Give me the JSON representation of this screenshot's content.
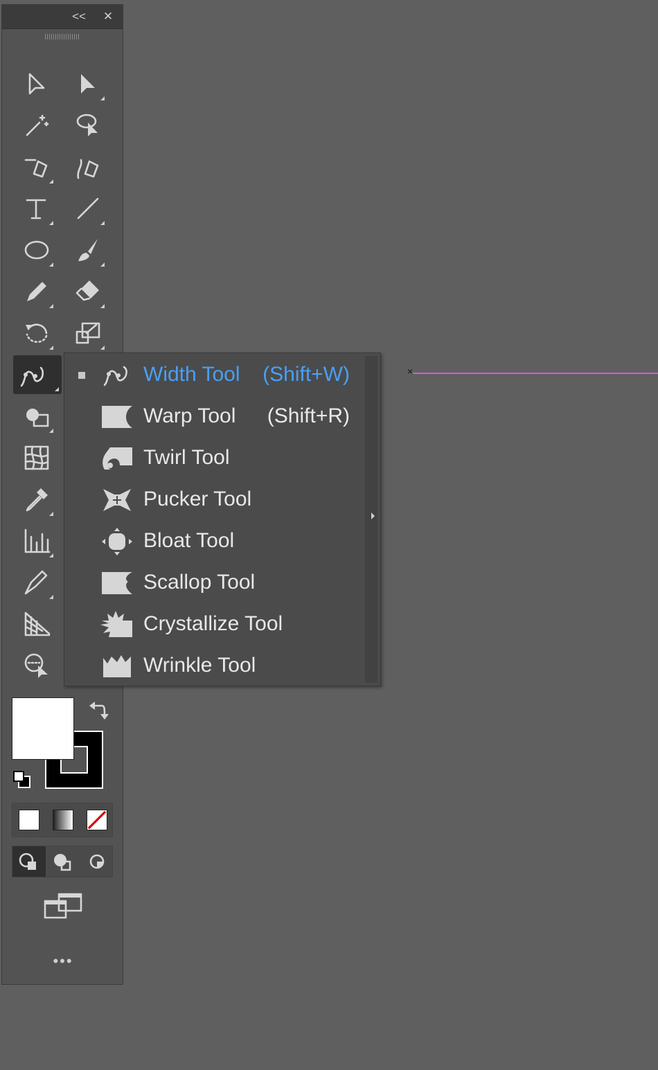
{
  "toolbar": {
    "collapse_label": "<<",
    "close_label": "✕",
    "more_label": "•••",
    "tools": [
      {
        "name": "selection-tool",
        "icon": "selection-arrow-icon"
      },
      {
        "name": "direct-selection-tool",
        "icon": "direct-selection-arrow-icon"
      },
      {
        "name": "magic-wand-tool",
        "icon": "magic-wand-icon"
      },
      {
        "name": "lasso-tool",
        "icon": "lasso-icon"
      },
      {
        "name": "pen-tool",
        "icon": "pen-icon"
      },
      {
        "name": "curvature-tool",
        "icon": "curvature-pen-icon"
      },
      {
        "name": "type-tool",
        "icon": "type-icon"
      },
      {
        "name": "line-segment-tool",
        "icon": "line-icon"
      },
      {
        "name": "ellipse-tool",
        "icon": "ellipse-icon"
      },
      {
        "name": "paintbrush-tool",
        "icon": "paintbrush-icon"
      },
      {
        "name": "pencil-tool",
        "icon": "pencil-icon"
      },
      {
        "name": "eraser-tool",
        "icon": "eraser-icon"
      },
      {
        "name": "rotate-tool",
        "icon": "rotate-icon"
      },
      {
        "name": "scale-tool",
        "icon": "scale-icon"
      },
      {
        "name": "width-tool",
        "icon": "width-icon"
      },
      {
        "name": "shape-builder-tool",
        "icon": "shape-builder-icon"
      },
      {
        "name": "mesh-tool",
        "icon": "mesh-icon"
      },
      {
        "name": "eyedropper-tool",
        "icon": "eyedropper-icon"
      },
      {
        "name": "graph-tool",
        "icon": "column-graph-icon"
      },
      {
        "name": "slice-tool",
        "icon": "slice-icon"
      },
      {
        "name": "perspective-grid-tool",
        "icon": "perspective-grid-icon"
      },
      {
        "name": "zoom-tool",
        "icon": "zoom-icon"
      }
    ]
  },
  "flyout": {
    "items": [
      {
        "label": "Width Tool",
        "shortcut": "(Shift+W)",
        "selected": true,
        "icon": "width-icon"
      },
      {
        "label": "Warp Tool",
        "shortcut": "(Shift+R)",
        "selected": false,
        "icon": "warp-icon"
      },
      {
        "label": "Twirl Tool",
        "shortcut": "",
        "selected": false,
        "icon": "twirl-icon"
      },
      {
        "label": "Pucker Tool",
        "shortcut": "",
        "selected": false,
        "icon": "pucker-icon"
      },
      {
        "label": "Bloat Tool",
        "shortcut": "",
        "selected": false,
        "icon": "bloat-icon"
      },
      {
        "label": "Scallop Tool",
        "shortcut": "",
        "selected": false,
        "icon": "scallop-icon"
      },
      {
        "label": "Crystallize Tool",
        "shortcut": "",
        "selected": false,
        "icon": "crystallize-icon"
      },
      {
        "label": "Wrinkle Tool",
        "shortcut": "",
        "selected": false,
        "icon": "wrinkle-icon"
      }
    ]
  },
  "colors": {
    "fill": "#ffffff",
    "stroke": "#000000",
    "selected_accent": "#4a9ff5",
    "canvas_guide": "#d05cd0"
  }
}
